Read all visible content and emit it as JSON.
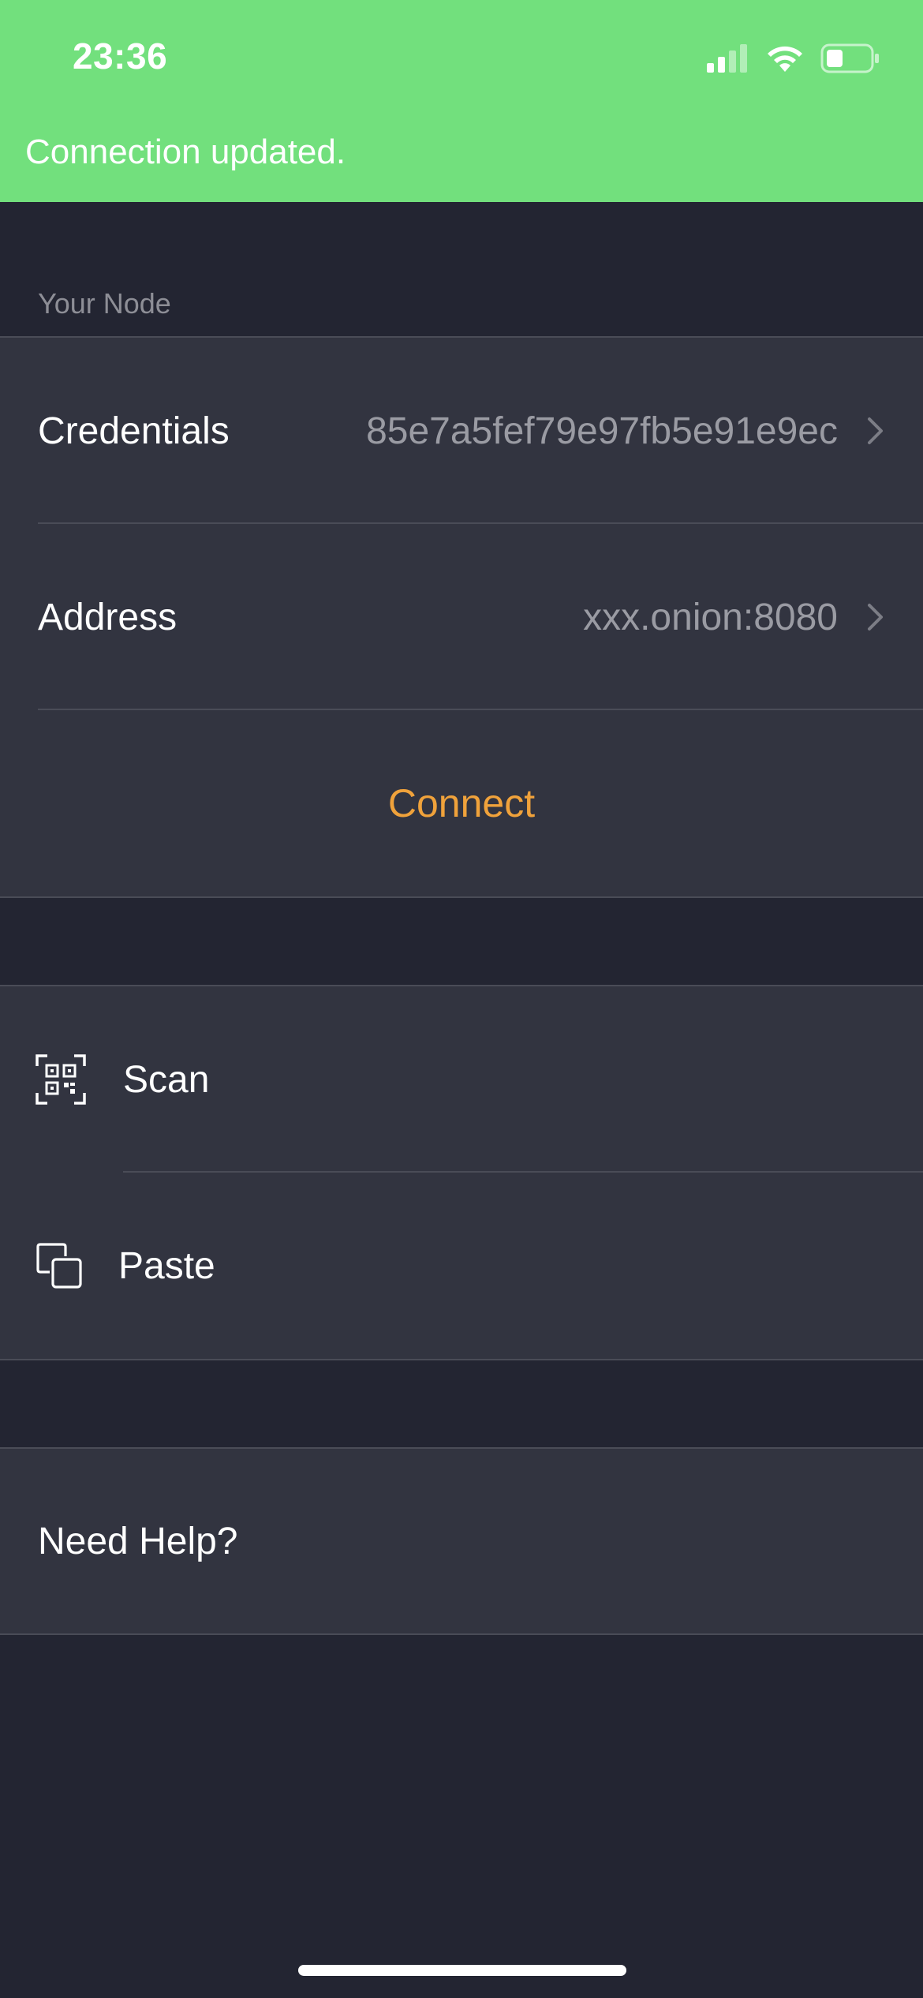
{
  "status_bar": {
    "time": "23:36",
    "icons": [
      "cellular-signal-icon",
      "wifi-icon",
      "battery-icon"
    ]
  },
  "toast": {
    "message": "Connection updated."
  },
  "node_section": {
    "header": "Your Node",
    "credentials_label": "Credentials",
    "credentials_value": "85e7a5fef79e97fb5e91e9ec",
    "address_label": "Address",
    "address_value": "xxx.onion:8080",
    "connect_label": "Connect"
  },
  "actions": {
    "scan_label": "Scan",
    "paste_label": "Paste"
  },
  "help": {
    "label": "Need Help?"
  },
  "colors": {
    "banner": "#72e07d",
    "background": "#232532",
    "cell": "#323440",
    "accent": "#f0a23b",
    "secondary_text": "#9a9ba3"
  }
}
